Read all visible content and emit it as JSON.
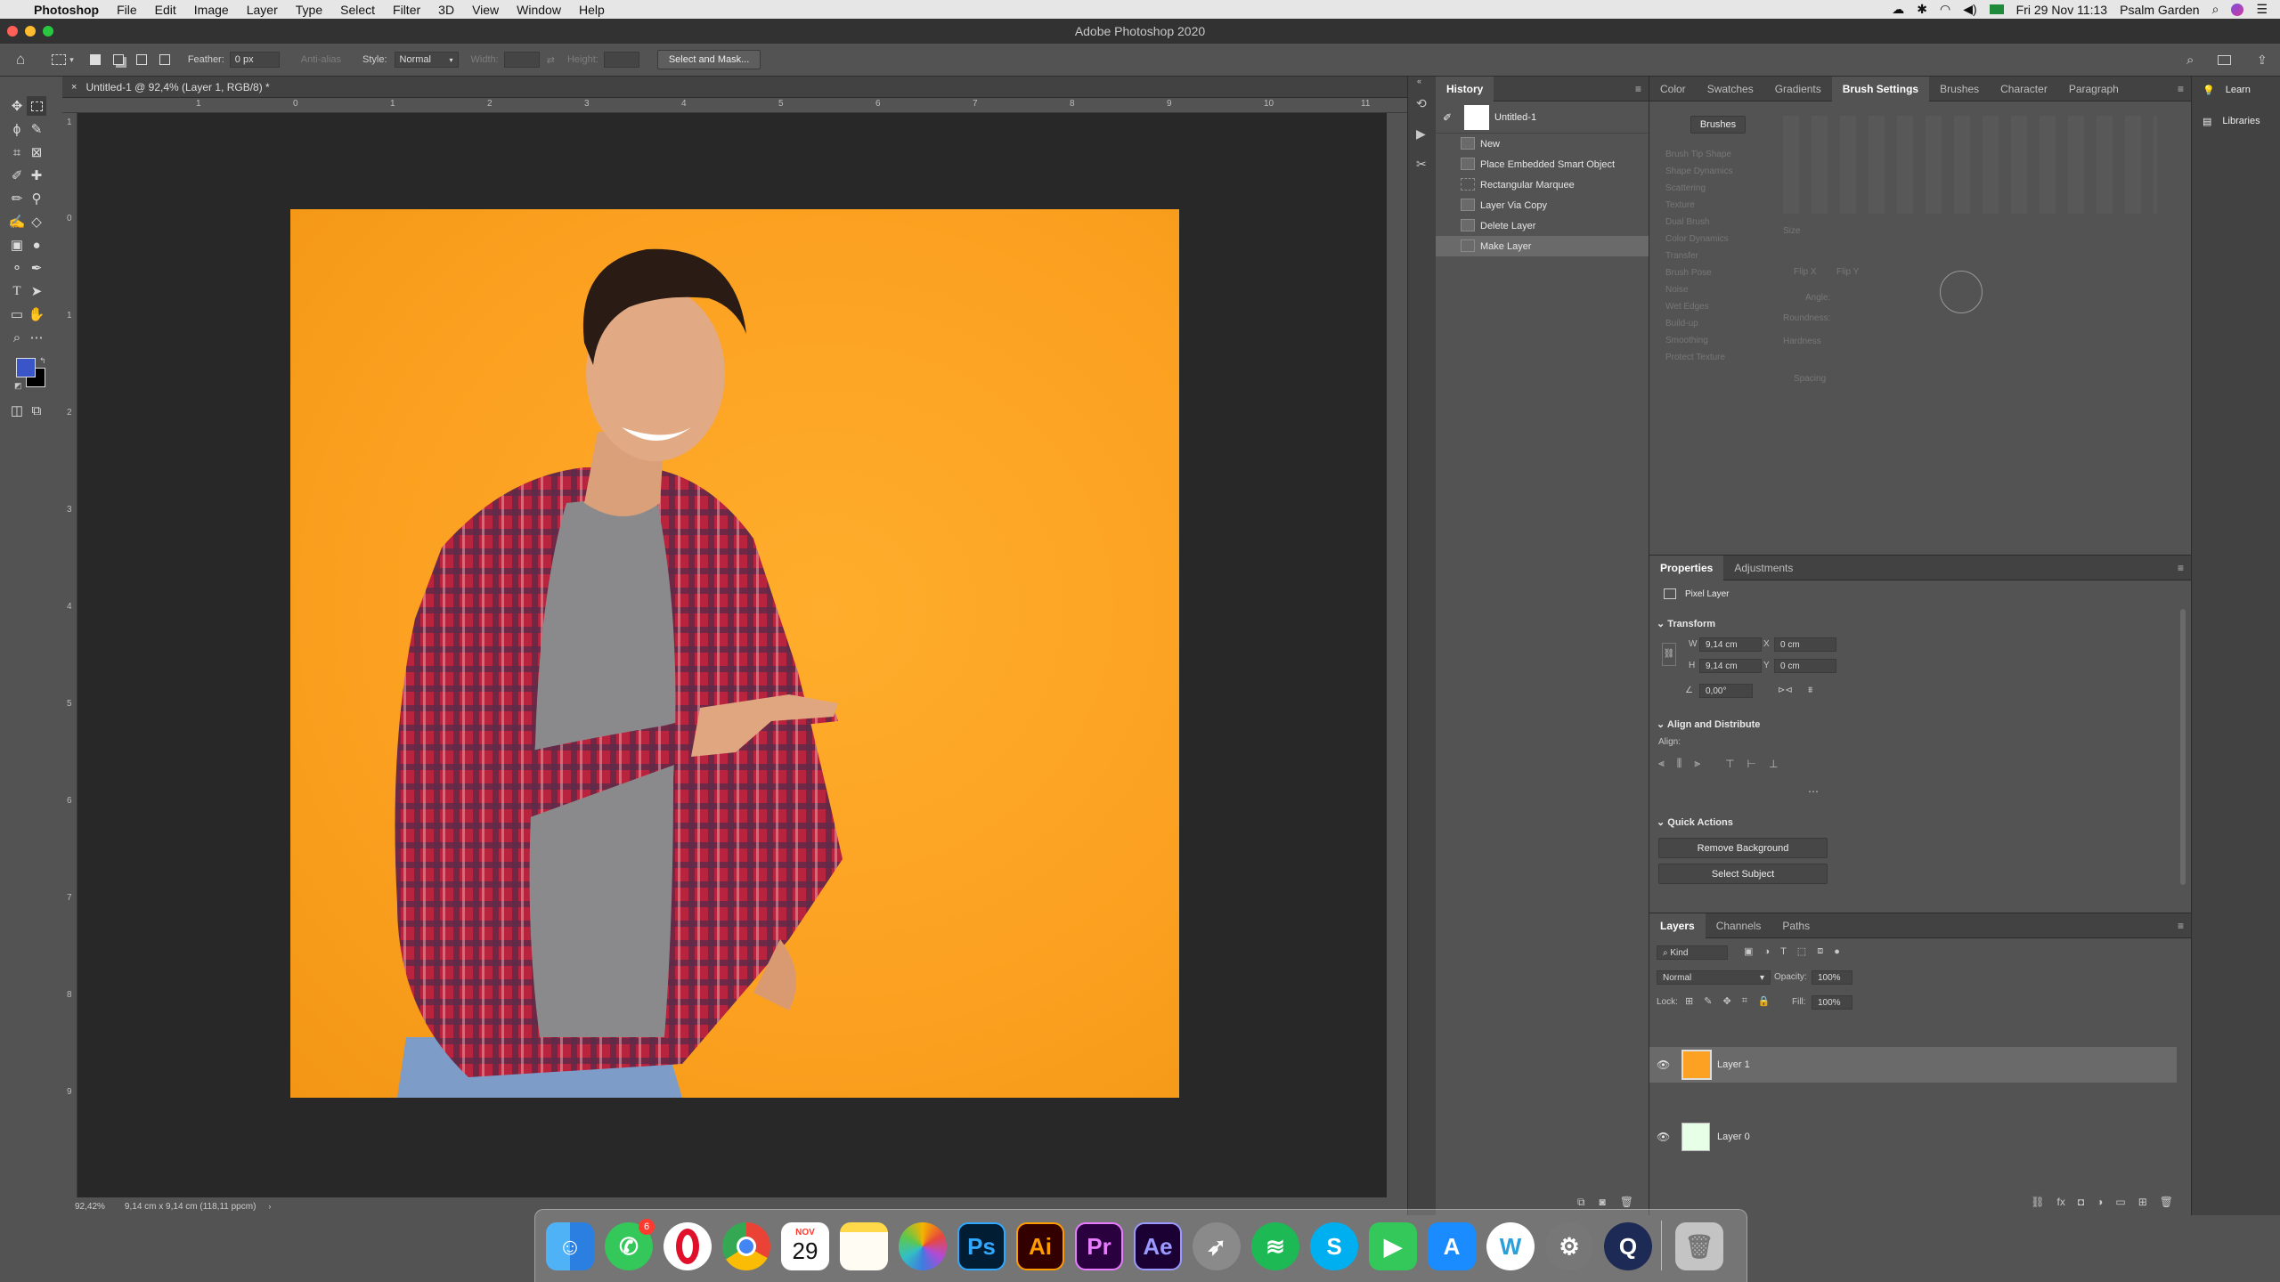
{
  "menubar": {
    "app_name": "Photoshop",
    "items": [
      "File",
      "Edit",
      "Image",
      "Layer",
      "Type",
      "Select",
      "Filter",
      "3D",
      "View",
      "Window",
      "Help"
    ],
    "clock": "Fri 29 Nov  11:13",
    "user": "Psalm Garden"
  },
  "window": {
    "title": "Adobe Photoshop 2020"
  },
  "options": {
    "feather_label": "Feather:",
    "feather_value": "0 px",
    "antialias_label": "Anti-alias",
    "style_label": "Style:",
    "style_value": "Normal",
    "width_label": "Width:",
    "height_label": "Height:",
    "select_mask_label": "Select and Mask..."
  },
  "document": {
    "tab_title": "Untitled-1 @ 92,4% (Layer 1, RGB/8) *",
    "zoom": "92,42%",
    "doc_size": "9,14 cm x 9,14 cm (118,11 ppcm)",
    "ruler_top": [
      "1",
      "0",
      "1",
      "2",
      "3",
      "4",
      "5",
      "6",
      "7",
      "8",
      "9",
      "10",
      "11"
    ],
    "ruler_left": [
      "1",
      "0",
      "1",
      "2",
      "3",
      "4",
      "5",
      "6",
      "7",
      "8",
      "9"
    ]
  },
  "history": {
    "tab": "History",
    "snapshot": "Untitled-1",
    "items": [
      "New",
      "Place Embedded Smart Object",
      "Rectangular Marquee",
      "Layer Via Copy",
      "Delete Layer",
      "Make Layer"
    ]
  },
  "brush_panel": {
    "tabs": [
      "Color",
      "Swatches",
      "Gradients",
      "Brush Settings",
      "Brushes",
      "Character",
      "Paragraph"
    ],
    "brushes_button": "Brushes",
    "options": [
      "Brush Tip Shape",
      "Shape Dynamics",
      "Scattering",
      "Texture",
      "Dual Brush",
      "Color Dynamics",
      "Transfer",
      "Brush Pose",
      "Noise",
      "Wet Edges",
      "Build-up",
      "Smoothing",
      "Protect Texture"
    ],
    "size_label": "Size",
    "flip_x": "Flip X",
    "flip_y": "Flip Y",
    "angle_label": "Angle:",
    "roundness_label": "Roundness:",
    "hardness_label": "Hardness",
    "spacing_label": "Spacing"
  },
  "side": {
    "learn": "Learn",
    "libraries": "Libraries"
  },
  "properties": {
    "tabs": [
      "Properties",
      "Adjustments"
    ],
    "kind": "Pixel Layer",
    "transform_label": "Transform",
    "w_label": "W",
    "w_value": "9,14 cm",
    "h_label": "H",
    "h_value": "9,14 cm",
    "x_label": "X",
    "x_value": "0 cm",
    "y_label": "Y",
    "y_value": "0 cm",
    "angle_value": "0,00°",
    "align_label": "Align and Distribute",
    "align_sub": "Align:",
    "quick_actions_label": "Quick Actions",
    "remove_bg": "Remove Background",
    "select_subject": "Select Subject"
  },
  "layers": {
    "tabs": [
      "Layers",
      "Channels",
      "Paths"
    ],
    "kind": "Kind",
    "blend_mode": "Normal",
    "opacity_label": "Opacity:",
    "opacity_value": "100%",
    "lock_label": "Lock:",
    "fill_label": "Fill:",
    "fill_value": "100%",
    "items": [
      "Layer 1",
      "Layer 0"
    ]
  },
  "dock": {
    "apps": [
      "finder",
      "whatsapp",
      "opera",
      "chrome",
      "calendar",
      "notes",
      "photos",
      "photoshop",
      "illustrator",
      "premiere",
      "after-effects",
      "launchpad",
      "spotify",
      "skype",
      "facetime",
      "app-store",
      "word",
      "system-prefs",
      "quicktime",
      "trash"
    ],
    "calendar_month": "NOV",
    "calendar_day": "29",
    "whatsapp_badge": "6",
    "ps": "Ps",
    "ai": "Ai",
    "pr": "Pr",
    "ae": "Ae"
  },
  "colors": {
    "foreground": "#3a55c8",
    "background": "#000000",
    "canvas_bg": "#fca121"
  }
}
